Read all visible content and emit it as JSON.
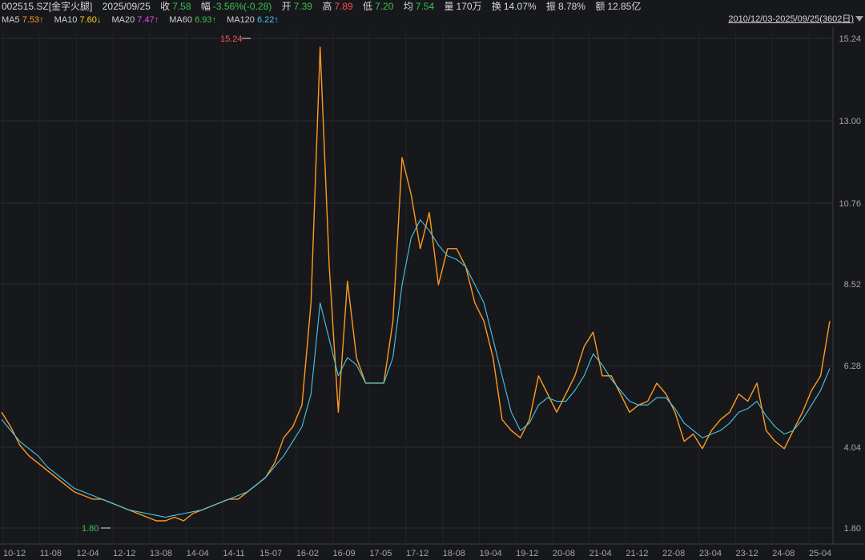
{
  "quote": {
    "code_name": "002515.SZ[金字火腿]",
    "date": "2025/09/25",
    "close_label": "收",
    "close": "7.58",
    "change_label": "幅",
    "change": "-3.56%(-0.28)",
    "open_label": "开",
    "open": "7.39",
    "high_label": "高",
    "high": "7.89",
    "low_label": "低",
    "low": "7.20",
    "avg_label": "均",
    "avg": "7.54",
    "volume_label": "量",
    "volume": "170万",
    "turnover_label": "换",
    "turnover": "14.07%",
    "amplitude_label": "振",
    "amplitude": "8.78%",
    "amount_label": "额",
    "amount": "12.85亿"
  },
  "ma": [
    {
      "label": "MA5",
      "value": "7.53↑",
      "color": "#e8e8e8",
      "value_color": "#ff9a1f"
    },
    {
      "label": "MA10",
      "value": "7.60↓",
      "color": "#e8e8e8",
      "value_color": "#ffd21f"
    },
    {
      "label": "MA20",
      "value": "7.47↑",
      "color": "#e8e8e8",
      "value_color": "#e052e0"
    },
    {
      "label": "MA60",
      "value": "6.93↑",
      "color": "#e8e8e8",
      "value_color": "#3ac24a"
    },
    {
      "label": "MA120",
      "value": "6.22↑",
      "color": "#e8e8e8",
      "value_color": "#48c8e8"
    }
  ],
  "range_text": "2010/12/03-2025/09/25(3602日)",
  "chart_data": {
    "type": "line",
    "ylim": [
      1.6,
      15.5
    ],
    "yticks": [
      "15.24",
      "13.00",
      "10.76",
      "8.52",
      "6.28",
      "4.04",
      "1.80"
    ],
    "xticks": [
      "10-12",
      "11-08",
      "12-04",
      "12-12",
      "13-08",
      "14-04",
      "14-11",
      "15-07",
      "16-02",
      "16-09",
      "17-05",
      "17-12",
      "18-08",
      "19-04",
      "19-12",
      "20-08",
      "21-04",
      "21-12",
      "22-08",
      "23-04",
      "23-12",
      "24-08",
      "25-04"
    ],
    "annotations": {
      "high": "15.24",
      "low": "1.80"
    },
    "series": [
      {
        "color": "#ff9a1f",
        "values": [
          5.0,
          4.6,
          4.1,
          3.8,
          3.6,
          3.4,
          3.2,
          3.0,
          2.8,
          2.7,
          2.6,
          2.6,
          2.5,
          2.4,
          2.3,
          2.2,
          2.1,
          2.0,
          2.0,
          2.1,
          2.0,
          2.2,
          2.3,
          2.4,
          2.5,
          2.6,
          2.6,
          2.8,
          3.0,
          3.2,
          3.6,
          4.3,
          4.6,
          5.2,
          8.0,
          15.0,
          9.0,
          5.0,
          8.6,
          6.5,
          5.8,
          5.8,
          5.8,
          7.5,
          12.0,
          11.0,
          9.5,
          10.5,
          8.5,
          9.5,
          9.5,
          9.0,
          8.0,
          7.5,
          6.5,
          4.8,
          4.5,
          4.3,
          4.8,
          6.0,
          5.5,
          5.0,
          5.5,
          6.0,
          6.8,
          7.2,
          6.0,
          6.0,
          5.5,
          5.0,
          5.2,
          5.3,
          5.8,
          5.5,
          5.0,
          4.2,
          4.4,
          4.0,
          4.5,
          4.8,
          5.0,
          5.5,
          5.3,
          5.8,
          4.5,
          4.2,
          4.0,
          4.5,
          5.0,
          5.6,
          6.0,
          7.5
        ]
      },
      {
        "color": "#48c8e8",
        "values": [
          4.8,
          4.5,
          4.2,
          4.0,
          3.8,
          3.5,
          3.3,
          3.1,
          2.9,
          2.8,
          2.7,
          2.6,
          2.5,
          2.4,
          2.3,
          2.25,
          2.2,
          2.15,
          2.1,
          2.15,
          2.2,
          2.25,
          2.3,
          2.4,
          2.5,
          2.6,
          2.7,
          2.8,
          3.0,
          3.2,
          3.5,
          3.8,
          4.2,
          4.6,
          5.5,
          8.0,
          7.0,
          6.0,
          6.5,
          6.3,
          5.8,
          5.8,
          5.8,
          6.5,
          8.5,
          9.8,
          10.3,
          10.0,
          9.6,
          9.3,
          9.2,
          9.0,
          8.5,
          8.0,
          7.0,
          6.0,
          5.0,
          4.5,
          4.7,
          5.2,
          5.4,
          5.3,
          5.3,
          5.6,
          6.0,
          6.6,
          6.3,
          5.9,
          5.6,
          5.3,
          5.2,
          5.2,
          5.4,
          5.4,
          5.1,
          4.7,
          4.5,
          4.3,
          4.4,
          4.5,
          4.7,
          5.0,
          5.1,
          5.3,
          4.9,
          4.6,
          4.4,
          4.5,
          4.8,
          5.2,
          5.6,
          6.2
        ]
      }
    ]
  }
}
